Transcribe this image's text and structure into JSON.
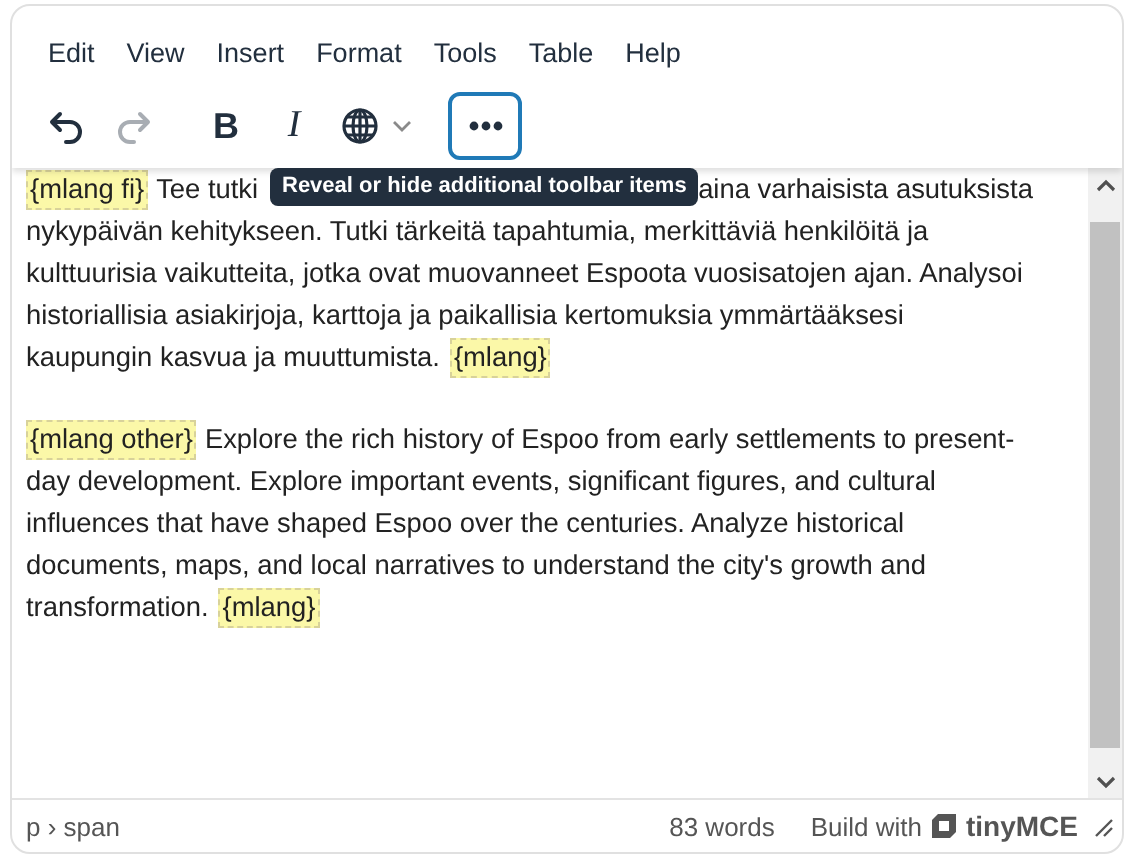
{
  "menu": [
    "Edit",
    "View",
    "Insert",
    "Format",
    "Tools",
    "Table",
    "Help"
  ],
  "toolbar": [
    {
      "kind": "undo",
      "disabled": false,
      "focused": false
    },
    {
      "kind": "redo",
      "disabled": true,
      "focused": false
    },
    {
      "kind": "bold",
      "glyph": "B",
      "disabled": false,
      "focused": false
    },
    {
      "kind": "italic",
      "glyph": "I",
      "disabled": false,
      "focused": false
    },
    {
      "kind": "language",
      "disabled": false,
      "focused": false
    },
    {
      "kind": "more",
      "disabled": false,
      "focused": true
    }
  ],
  "tooltip": "Reveal or hide additional toolbar items",
  "paragraphs": [
    {
      "lines": [
        [
          {
            "kind": "tag",
            "text": "{mlang fi}"
          },
          {
            "kind": "text",
            "text": "Tee tutki"
          },
          {
            "kind": "gap"
          },
          {
            "kind": "text",
            "text": "aina varhaisista asutuksista"
          }
        ],
        [
          {
            "kind": "text",
            "text": "nykypäivän kehitykseen. Tutki tärkeitä tapahtumia, merkittäviä henkilöitä ja"
          }
        ],
        [
          {
            "kind": "text",
            "text": "kulttuurisia vaikutteita, jotka ovat muovanneet Espoota vuosisatojen ajan. Analysoi"
          }
        ],
        [
          {
            "kind": "text",
            "text": "historiallisia asiakirjoja, karttoja ja paikallisia kertomuksia ymmärtääksesi"
          }
        ],
        [
          {
            "kind": "text",
            "text": "kaupungin kasvua ja muuttumista."
          },
          {
            "kind": "tag",
            "text": "{mlang}"
          }
        ]
      ]
    },
    {
      "lines": [
        [
          {
            "kind": "tag",
            "text": "{mlang other}"
          },
          {
            "kind": "text",
            "text": "Explore the rich history of Espoo from early settlements to present-"
          }
        ],
        [
          {
            "kind": "text",
            "text": "day development. Explore important events, significant figures, and cultural"
          }
        ],
        [
          {
            "kind": "text",
            "text": "influences that have shaped Espoo over the centuries. Analyze historical"
          }
        ],
        [
          {
            "kind": "text",
            "text": "documents, maps, and local narratives to understand the city's growth and"
          }
        ],
        [
          {
            "kind": "text",
            "text": "transformation."
          },
          {
            "kind": "tag",
            "text": "{mlang}"
          }
        ]
      ]
    }
  ],
  "status_bar": {
    "path": "p › span",
    "word_count": "83 words",
    "branding": "Build with",
    "brand": "tinyMCE"
  }
}
